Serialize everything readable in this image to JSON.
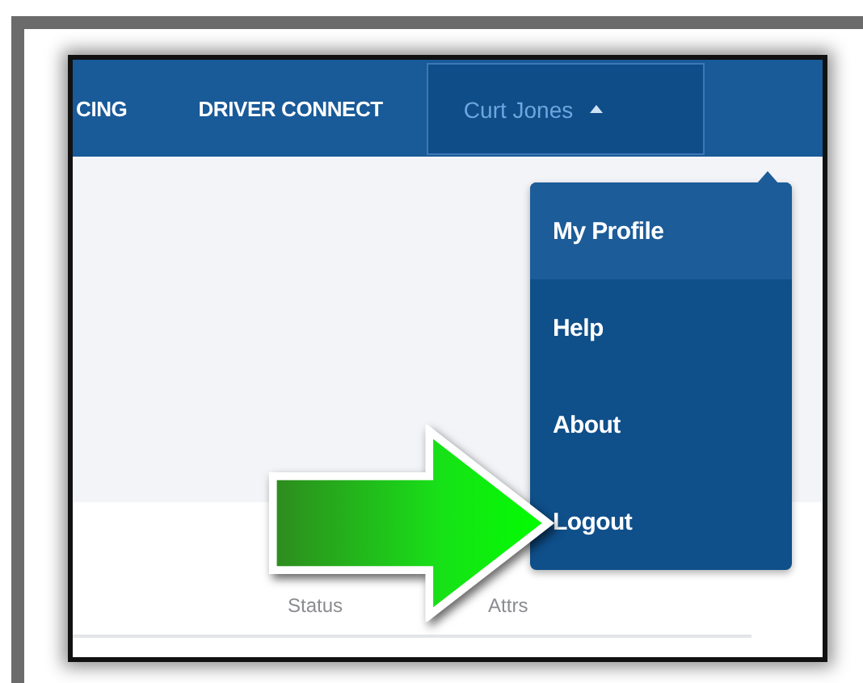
{
  "nav": {
    "items": [
      {
        "label": "CING"
      },
      {
        "label": "DRIVER CONNECT"
      }
    ]
  },
  "user_menu": {
    "label": "Curt Jones",
    "expanded": true,
    "items": [
      {
        "label": "My Profile",
        "selected": true
      },
      {
        "label": "Help",
        "selected": false
      },
      {
        "label": "About",
        "selected": false
      },
      {
        "label": "Logout",
        "selected": false
      }
    ]
  },
  "table": {
    "columns": [
      "Status",
      "Attrs"
    ]
  }
}
